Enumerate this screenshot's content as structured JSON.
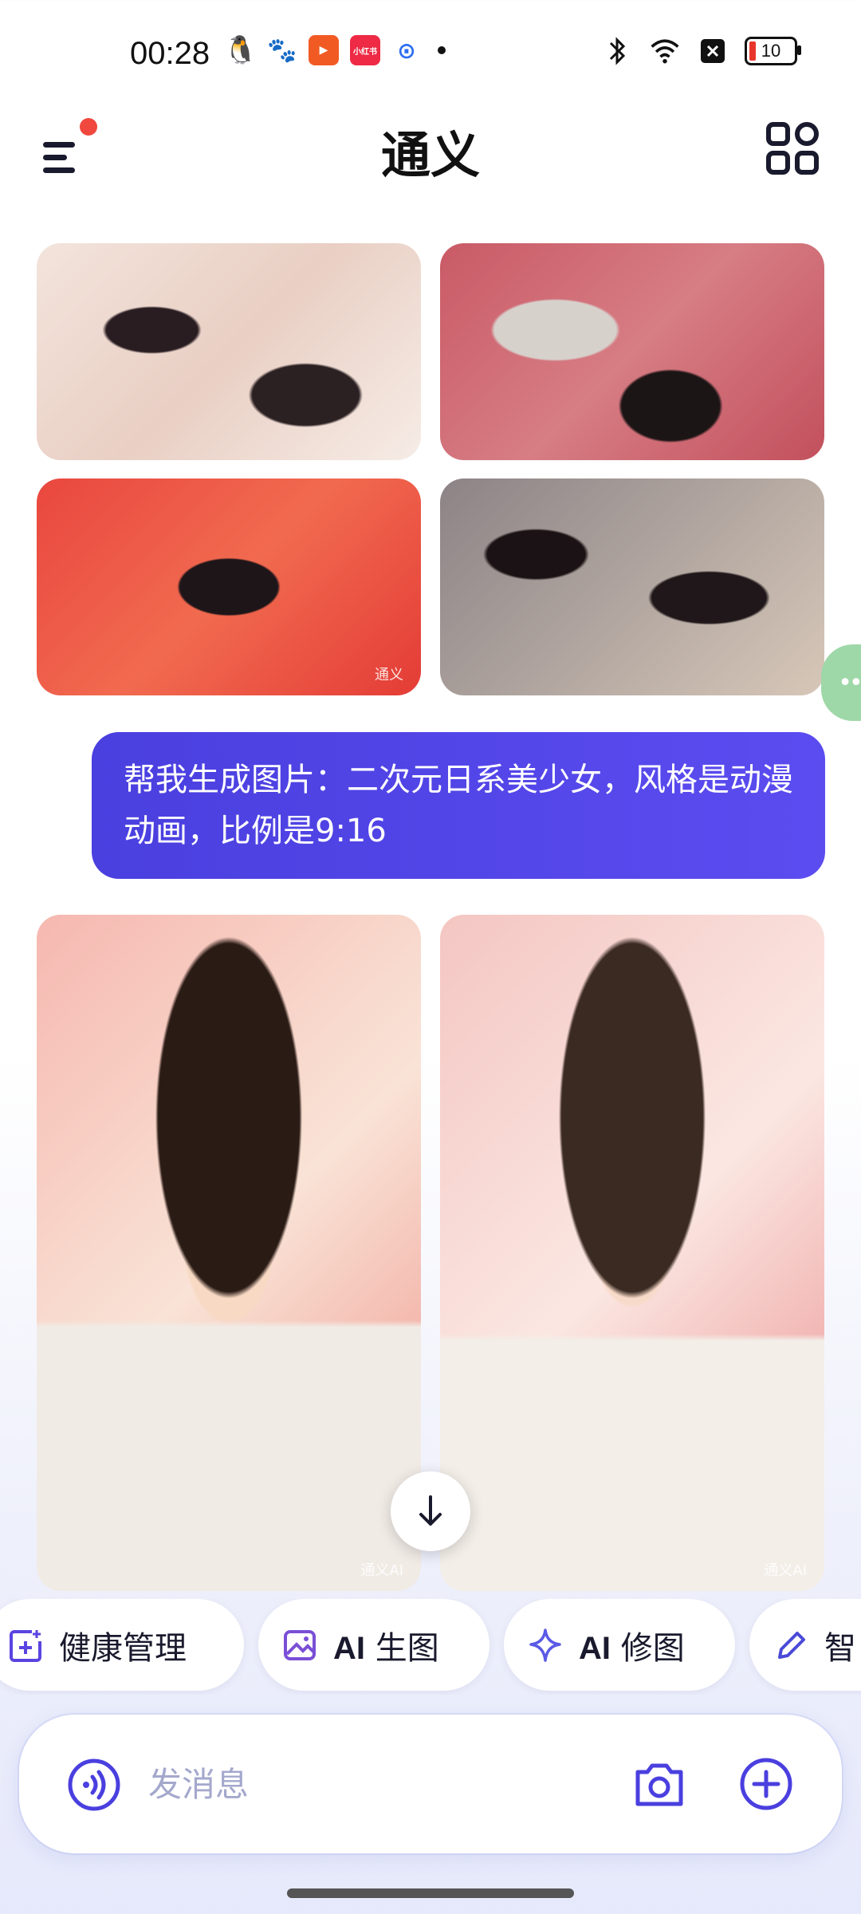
{
  "status_bar": {
    "time": "00:28",
    "battery_level": "10",
    "notification_icons": [
      "qq-icon",
      "baidu-icon",
      "video-app-icon",
      "xiaohongshu-icon",
      "map-icon"
    ],
    "system_icons": [
      "bluetooth-icon",
      "wifi-icon",
      "no-sim-icon",
      "battery-icon"
    ]
  },
  "header": {
    "title": "通义",
    "menu_icon": "menu-icon",
    "apps_icon": "apps-grid-icon",
    "has_notification_dot": true
  },
  "chat": {
    "previous_images": {
      "count": 4,
      "watermark": "通义"
    },
    "user_message": "帮我生成图片：二次元日系美少女，风格是动漫动画，比例是9:16",
    "generated_images": {
      "count": 2,
      "watermark": "通义AI"
    }
  },
  "quick_actions": [
    {
      "label": "健康管理",
      "icon": "health-plus-icon"
    },
    {
      "label_ai": "AI",
      "label_rest": " 生图",
      "icon": "image-gen-icon"
    },
    {
      "label_ai": "AI",
      "label_rest": " 修图",
      "icon": "sparkle-icon"
    },
    {
      "label": "智",
      "icon": "pen-ai-icon"
    }
  ],
  "input": {
    "placeholder": "发消息"
  },
  "colors": {
    "accent": "#4a3fdf",
    "notification_dot": "#f0483e",
    "side_float": "#9fd8a8"
  }
}
